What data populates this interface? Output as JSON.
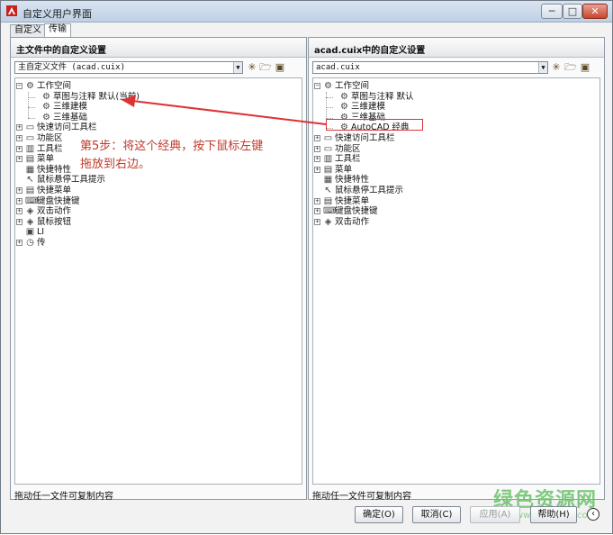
{
  "window": {
    "title": "自定义用户界面",
    "minimize": "─",
    "maximize": "□",
    "close": "✕"
  },
  "tabs": [
    {
      "label": "自定义",
      "active": false
    },
    {
      "label": "传输",
      "active": true
    }
  ],
  "left_panel": {
    "header": "主文件中的自定义设置",
    "combo_value": "主自定义文件 (acad.cuix)",
    "status": "拖动任一文件可复制内容",
    "tree": [
      {
        "label": "工作空间",
        "level": 0,
        "expander": "minus",
        "icon": "gear-icon",
        "glyph": "⚙"
      },
      {
        "label": "草图与注释 默认(当前)",
        "level": 1,
        "icon": "gear-icon",
        "glyph": "⚙"
      },
      {
        "label": "三维建模",
        "level": 1,
        "icon": "gear-icon",
        "glyph": "⚙"
      },
      {
        "label": "三维基础",
        "level": 1,
        "icon": "gear-icon",
        "glyph": "⚙"
      },
      {
        "label": "快速访问工具栏",
        "level": 0,
        "expander": "plus",
        "icon": "toolbar-icon",
        "glyph": "▭"
      },
      {
        "label": "功能区",
        "level": 0,
        "expander": "plus",
        "icon": "folder-icon",
        "glyph": "▭"
      },
      {
        "label": "工具栏",
        "level": 0,
        "expander": "plus",
        "icon": "toolbar-icon",
        "glyph": "▥"
      },
      {
        "label": "菜单",
        "level": 0,
        "expander": "plus",
        "icon": "menu-icon",
        "glyph": "▤"
      },
      {
        "label": "快捷特性",
        "level": 0,
        "icon": "properties-icon",
        "glyph": "▦"
      },
      {
        "label": "鼠标悬停工具提示",
        "level": 0,
        "icon": "tooltip-icon",
        "glyph": "↖"
      },
      {
        "label": "快捷菜单",
        "level": 0,
        "expander": "plus",
        "icon": "shortcut-menu-icon",
        "glyph": "▤"
      },
      {
        "label": "键盘快捷键",
        "level": 0,
        "expander": "plus",
        "icon": "keyboard-icon",
        "glyph": "⌨"
      },
      {
        "label": "双击动作",
        "level": 0,
        "expander": "plus",
        "icon": "double-click-icon",
        "glyph": "◈"
      },
      {
        "label": "鼠标按钮",
        "level": 0,
        "expander": "plus",
        "icon": "mouse-icon",
        "glyph": "◈"
      },
      {
        "label": "LI",
        "level": 0,
        "icon": "lisp-icon",
        "glyph": "▣"
      },
      {
        "label": "传",
        "level": 0,
        "expander": "plus",
        "icon": "legacy-icon",
        "glyph": "◷"
      }
    ]
  },
  "right_panel": {
    "header": "acad.cuix中的自定义设置",
    "combo_value": "acad.cuix",
    "status": "拖动任一文件可复制内容",
    "tree": [
      {
        "label": "工作空间",
        "level": 0,
        "expander": "minus",
        "icon": "gear-icon",
        "glyph": "⚙"
      },
      {
        "label": "草图与注释 默认",
        "level": 1,
        "icon": "gear-icon",
        "glyph": "⚙"
      },
      {
        "label": "三维建模",
        "level": 1,
        "icon": "gear-icon",
        "glyph": "⚙"
      },
      {
        "label": "三维基础",
        "level": 1,
        "icon": "gear-icon",
        "glyph": "⚙"
      },
      {
        "label": "AutoCAD 经典",
        "level": 1,
        "icon": "gear-icon",
        "glyph": "⚙"
      },
      {
        "label": "快速访问工具栏",
        "level": 0,
        "expander": "plus",
        "icon": "toolbar-icon",
        "glyph": "▭"
      },
      {
        "label": "功能区",
        "level": 0,
        "expander": "plus",
        "icon": "folder-icon",
        "glyph": "▭"
      },
      {
        "label": "工具栏",
        "level": 0,
        "expander": "plus",
        "icon": "toolbar-icon",
        "glyph": "▥"
      },
      {
        "label": "菜单",
        "level": 0,
        "expander": "plus",
        "icon": "menu-icon",
        "glyph": "▤"
      },
      {
        "label": "快捷特性",
        "level": 0,
        "icon": "properties-icon",
        "glyph": "▦"
      },
      {
        "label": "鼠标悬停工具提示",
        "level": 0,
        "icon": "tooltip-icon",
        "glyph": "↖"
      },
      {
        "label": "快捷菜单",
        "level": 0,
        "expander": "plus",
        "icon": "shortcut-menu-icon",
        "glyph": "▤"
      },
      {
        "label": "键盘快捷键",
        "level": 0,
        "expander": "plus",
        "icon": "keyboard-icon",
        "glyph": "⌨"
      },
      {
        "label": "双击动作",
        "level": 0,
        "expander": "plus",
        "icon": "double-click-icon",
        "glyph": "◈"
      }
    ]
  },
  "annotation": {
    "line1": "第5步：将这个经典，按下鼠标左键",
    "line2": "拖放到右边。",
    "color": "#c0392b"
  },
  "buttons": {
    "ok": "确定(O)",
    "cancel": "取消(C)",
    "apply": "应用(A)",
    "help": "帮助(H)",
    "back_glyph": "‹"
  },
  "watermark": {
    "text": "绿色资源网",
    "url": "www.downcc.com"
  }
}
